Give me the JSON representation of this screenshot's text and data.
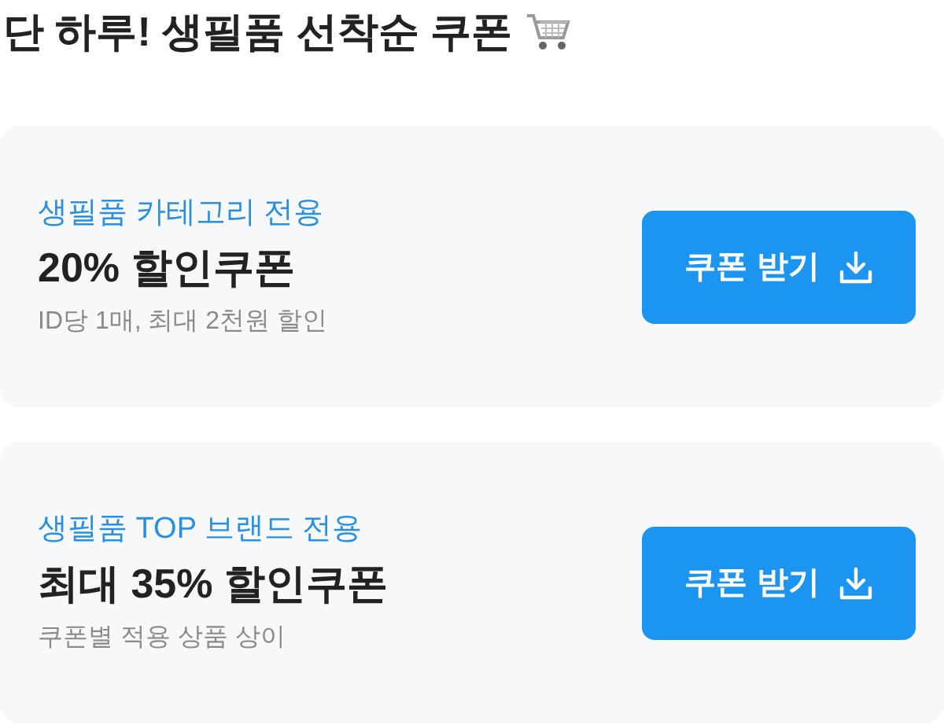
{
  "heading": "단 하루! 생필품 선착순 쿠폰",
  "coupons": [
    {
      "category": "생필품 카테고리 전용",
      "title": "20% 할인쿠폰",
      "note": "ID당 1매, 최대 2천원 할인",
      "button": "쿠폰 받기"
    },
    {
      "category": "생필품 TOP 브랜드 전용",
      "title": "최대 35% 할인쿠폰",
      "note": "쿠폰별 적용 상품 상이",
      "button": "쿠폰 받기"
    }
  ]
}
